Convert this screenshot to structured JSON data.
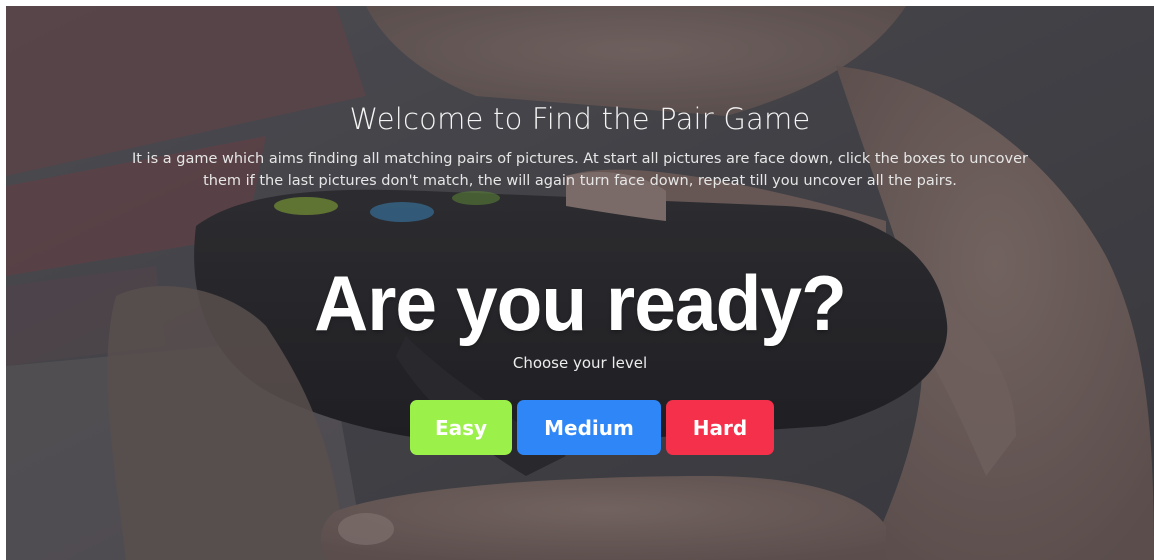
{
  "welcome": {
    "title": "Welcome to Find the Pair Game",
    "description": "It is a game which aims finding all matching pairs of pictures. At start all pictures are face down, click the boxes to uncover them if the last pictures don't match, the will again turn face down, repeat till you uncover all the pairs."
  },
  "ready": {
    "heading": "Are you ready?",
    "choose_label": "Choose your level"
  },
  "levels": [
    {
      "label": "Easy",
      "color": "#9cf04a"
    },
    {
      "label": "Medium",
      "color": "#2f86f6"
    },
    {
      "label": "Hard",
      "color": "#f4304a"
    }
  ],
  "colors": {
    "overlay_text": "#ffffff"
  }
}
